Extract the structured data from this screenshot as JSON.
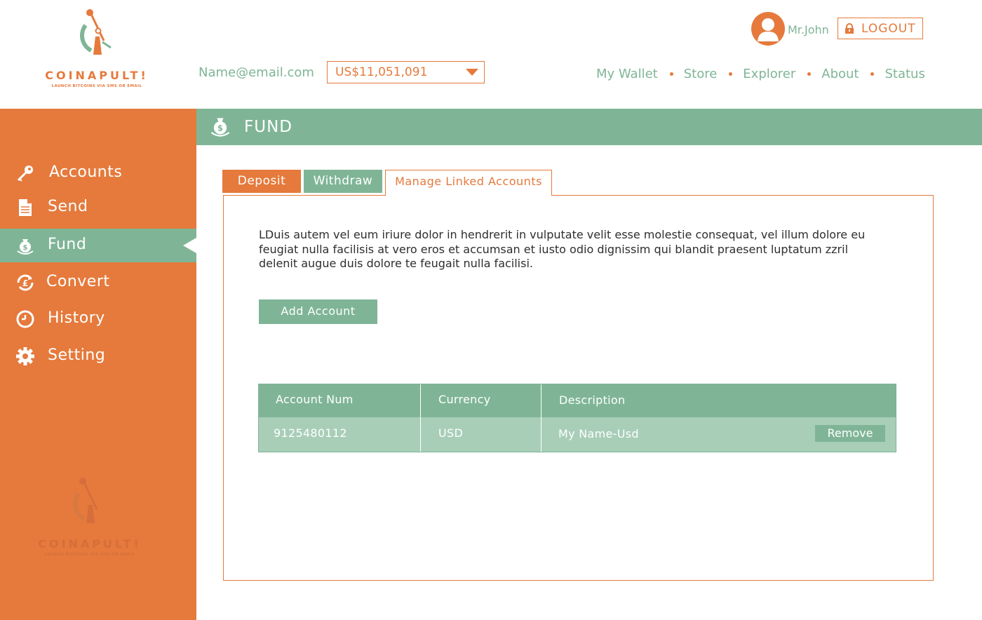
{
  "brand": {
    "name": "COINAPULT!",
    "tagline": "LAUNCH BITCOINS VIA SMS OR EMAIL"
  },
  "header": {
    "email": "Name@email.com",
    "balance": "US$11,051,091",
    "user_name": "Mr.John",
    "logout_label": "LOGOUT",
    "nav": [
      {
        "label": "My Wallet"
      },
      {
        "label": "Store"
      },
      {
        "label": "Explorer"
      },
      {
        "label": "About"
      },
      {
        "label": "Status"
      }
    ]
  },
  "sidebar": {
    "items": [
      {
        "label": "Accounts",
        "icon": "key-icon"
      },
      {
        "label": "Send",
        "icon": "document-icon"
      },
      {
        "label": "Fund",
        "icon": "money-bag-icon",
        "active": true
      },
      {
        "label": "Convert",
        "icon": "pound-refresh-icon"
      },
      {
        "label": "History",
        "icon": "clock-icon"
      },
      {
        "label": "Setting",
        "icon": "gear-icon"
      }
    ]
  },
  "section": {
    "title": "FUND",
    "icon": "money-bag-icon"
  },
  "tabs": [
    {
      "label": "Deposit"
    },
    {
      "label": "Withdraw"
    },
    {
      "label": "Manage Linked Accounts",
      "active": true
    }
  ],
  "panel": {
    "description": "LDuis autem vel eum iriure dolor in hendrerit in vulputate velit esse molestie consequat, vel illum dolore eu feugiat nulla facilisis at vero eros et accumsan et iusto odio dignissim qui blandit praesent luptatum zzril delenit augue duis dolore te feugait nulla facilisi.",
    "add_button": "Add Account",
    "table": {
      "headers": [
        "Account Num",
        "Currency",
        "Description"
      ],
      "rows": [
        {
          "account_num": "9125480112",
          "currency": "USD",
          "description": "My Name-Usd",
          "action": "Remove"
        }
      ]
    }
  },
  "colors": {
    "orange": "#e57a3c",
    "green": "#7fb596",
    "light_green": "#a8ceb8"
  }
}
